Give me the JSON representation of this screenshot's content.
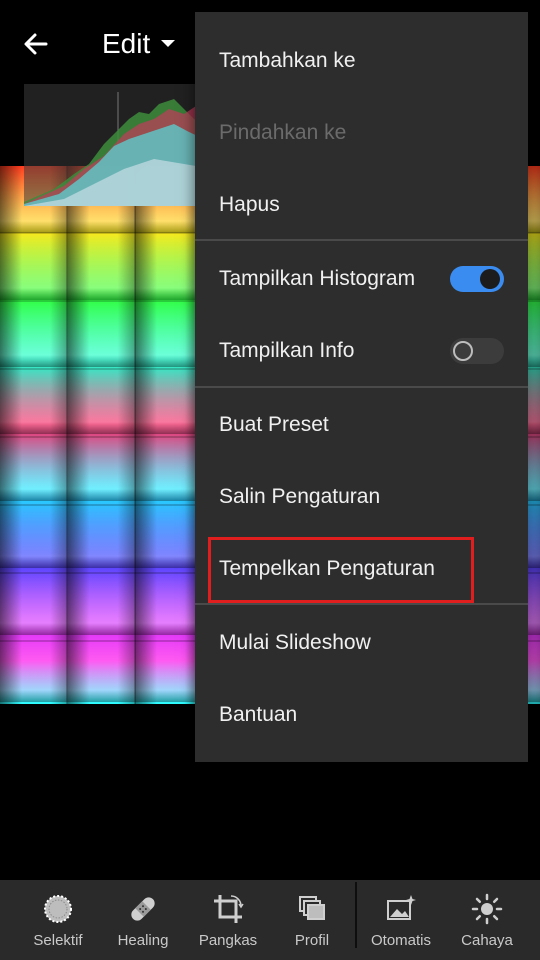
{
  "header": {
    "title": "Edit",
    "back_icon": "arrow-left-icon",
    "dropdown_icon": "caret-down-icon"
  },
  "menu": {
    "items": [
      {
        "label": "Tambahkan ke",
        "enabled": true
      },
      {
        "label": "Pindahkan ke",
        "enabled": false
      },
      {
        "label": "Hapus",
        "enabled": true
      },
      {
        "label": "Tampilkan Histogram",
        "toggle": true,
        "toggle_on": true
      },
      {
        "label": "Tampilkan Info",
        "toggle": true,
        "toggle_on": false
      },
      {
        "label": "Buat Preset",
        "enabled": true
      },
      {
        "label": "Salin Pengaturan",
        "enabled": true
      },
      {
        "label": "Tempelkan Pengaturan",
        "enabled": true,
        "highlighted": true
      },
      {
        "label": "Mulai Slideshow",
        "enabled": true
      },
      {
        "label": "Bantuan",
        "enabled": true
      }
    ]
  },
  "toolbar": {
    "tools": [
      {
        "label": "Selektif",
        "icon": "selective-icon"
      },
      {
        "label": "Healing",
        "icon": "bandage-icon"
      },
      {
        "label": "Pangkas",
        "icon": "crop-icon"
      },
      {
        "label": "Profil",
        "icon": "profile-icon"
      },
      {
        "label": "Otomatis",
        "icon": "auto-icon"
      },
      {
        "label": "Cahaya",
        "icon": "sun-icon"
      }
    ]
  },
  "colors": {
    "toggle_on": "#3b8cf0",
    "highlight_border": "#e01e1e",
    "menu_bg": "#2d2d2d",
    "toolbar_bg": "#2a2a2a"
  }
}
